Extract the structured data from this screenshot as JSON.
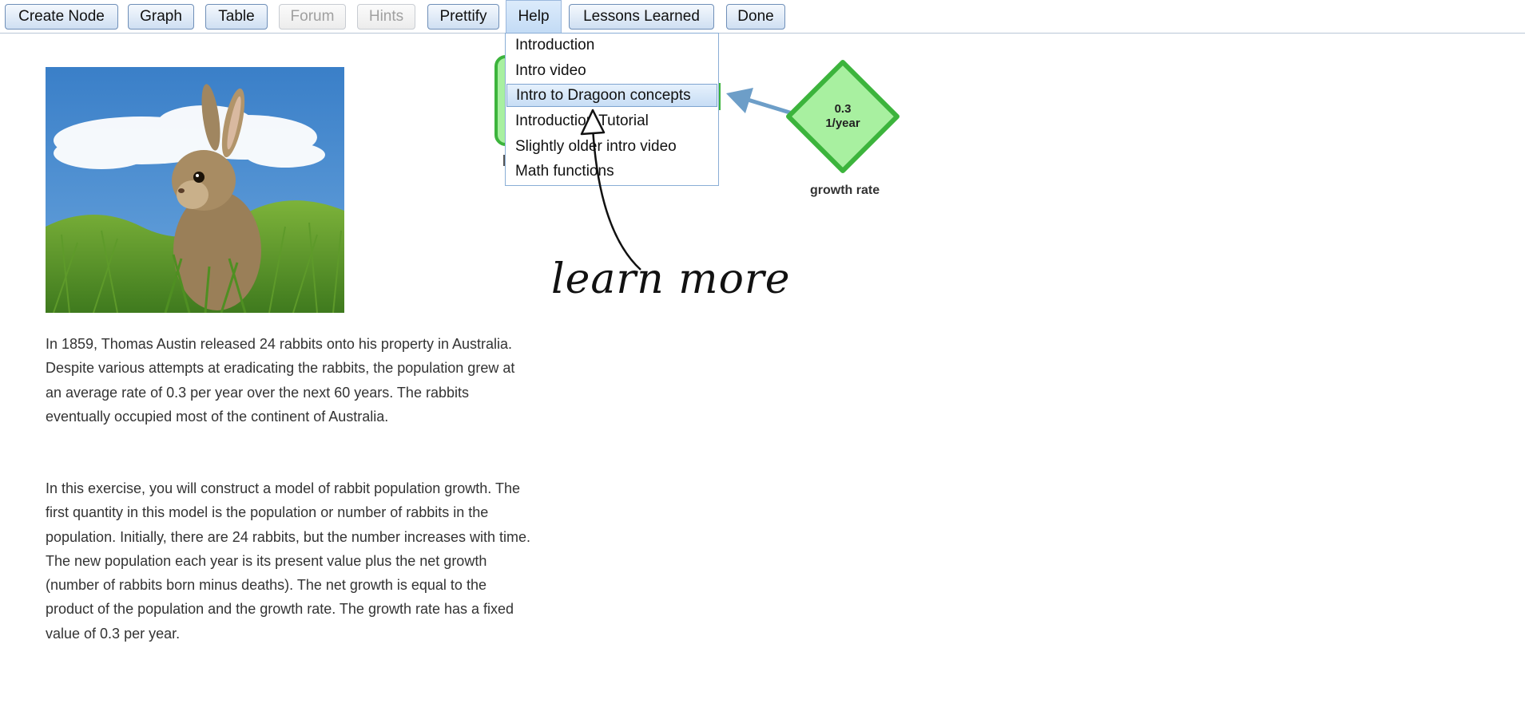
{
  "toolbar": {
    "buttons": [
      "Create Node",
      "Graph",
      "Table",
      "Forum",
      "Hints",
      "Prettify",
      "Help",
      "Lessons Learned",
      "Done"
    ]
  },
  "help_menu": {
    "items": [
      "Introduction",
      "Intro video",
      "Intro to Dragoon concepts",
      "Introduction Tutorial",
      "Slightly older intro video",
      "Math functions"
    ],
    "highlighted": "Intro to Dragoon concepts"
  },
  "problem": {
    "paragraph1": "In 1859, Thomas Austin released 24 rabbits onto his property in Australia. Despite various attempts at eradicating the rabbits, the population grew at an average rate of 0.3 per year over the next 60 years. The rabbits eventually occupied most of the continent of Australia.",
    "paragraph2": "In this exercise, you will construct a model of rabbit population growth. The first quantity in this model is the population or number of rabbits in the population. Initially, there are 24 rabbits, but the number increases with time. The new population each year is its present value plus the net growth (number of rabbits born minus deaths). The net growth is equal to the product of the population and the growth rate. The growth rate has a fixed value of 0.3 per year."
  },
  "graph": {
    "growth_rate_node": {
      "value": "0.3",
      "unit": "1/year",
      "label": "growth rate"
    }
  },
  "annotation": {
    "text": "learn more"
  },
  "colors": {
    "button_border": "#6f8fb8",
    "node_fill": "#a8f0a0",
    "node_border": "#3cb43c",
    "arrow": "#6d9ec8",
    "menu_highlight": "#c7ddf5"
  }
}
